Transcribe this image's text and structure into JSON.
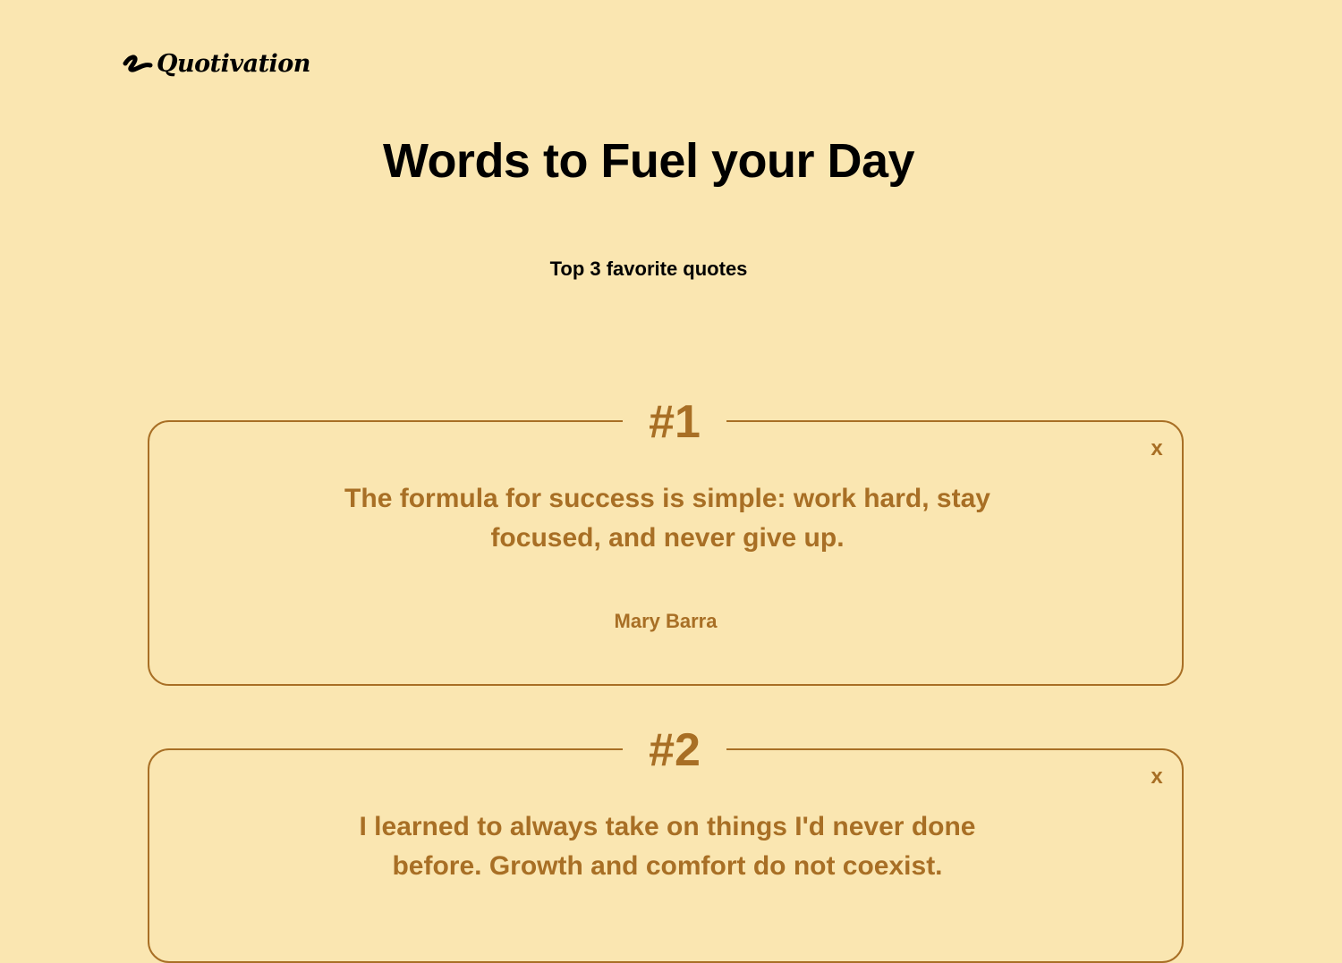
{
  "header": {
    "logo_text": "Quotivation",
    "logo_icon": "squiggle-icon"
  },
  "hero": {
    "title": "Words to Fuel your Day",
    "subtitle": "Top 3 favorite quotes"
  },
  "quotes": [
    {
      "rank": "#1",
      "text": "The formula for success is simple: work hard, stay focused, and never give up.",
      "author": "Mary Barra",
      "remove_label": "x"
    },
    {
      "rank": "#2",
      "text": "I learned to always take on things I'd never done before. Growth and comfort do not coexist.",
      "author": "",
      "remove_label": "x"
    }
  ],
  "colors": {
    "background": "#fae6b1",
    "accent": "#a86f25",
    "text": "#000000"
  }
}
